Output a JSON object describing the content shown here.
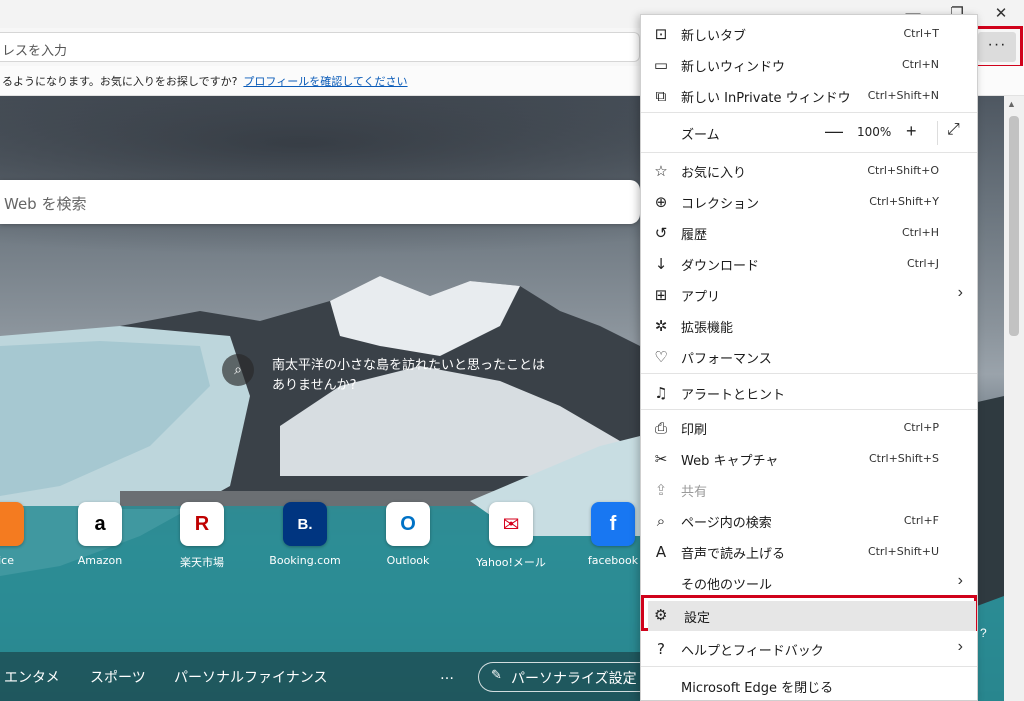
{
  "window": {
    "minimize_icon": "minimize-icon",
    "restore_icon": "restore-icon",
    "close_icon": "close-icon"
  },
  "address_bar": {
    "placeholder": "レスを入力",
    "more_button_label": "···"
  },
  "infobar": {
    "text": "るようになります。お気に入りをお探しですか?",
    "link": "プロフィールを確認してください"
  },
  "newtab": {
    "search_placeholder": "Web を検索",
    "caption_icon_label": "⌕",
    "caption": "南太平洋の小さな島を訪れたいと思ったことはありませんか?",
    "tiles": [
      {
        "label": "ice",
        "icon_text": "",
        "color": "#f47b20"
      },
      {
        "label": "Amazon",
        "icon_text": "a",
        "color": "#000000"
      },
      {
        "label": "楽天市場",
        "icon_text": "R",
        "color": "#bf0000"
      },
      {
        "label": "Booking.com",
        "icon_text": "B.",
        "color": "#003580"
      },
      {
        "label": "Outlook",
        "icon_text": "O",
        "color": "#0072c6"
      },
      {
        "label": "Yahoo!メール",
        "icon_text": "✉",
        "color": "#d6001c"
      },
      {
        "label": "facebook",
        "icon_text": "f",
        "color": "#1877f2"
      }
    ],
    "nav": [
      "エンタメ",
      "スポーツ",
      "パーソナルファイナンス",
      "…"
    ],
    "personalize": "パーソナライズ設定",
    "right_hint": "?"
  },
  "menu": {
    "new_tab": {
      "label": "新しいタブ",
      "shortcut": "Ctrl+T",
      "icon": "new-tab-icon"
    },
    "new_window": {
      "label": "新しいウィンドウ",
      "shortcut": "Ctrl+N",
      "icon": "new-window-icon"
    },
    "inprivate": {
      "label": "新しい InPrivate ウィンドウ",
      "shortcut": "Ctrl+Shift+N",
      "icon": "inprivate-icon"
    },
    "zoom": {
      "label": "ズーム",
      "minus": "—",
      "value": "100%",
      "plus": "+",
      "fullscreen": "⤢"
    },
    "favorites": {
      "label": "お気に入り",
      "shortcut": "Ctrl+Shift+O",
      "icon": "favorites-icon"
    },
    "collections": {
      "label": "コレクション",
      "shortcut": "Ctrl+Shift+Y",
      "icon": "collections-icon"
    },
    "history": {
      "label": "履歴",
      "shortcut": "Ctrl+H",
      "icon": "history-icon"
    },
    "downloads": {
      "label": "ダウンロード",
      "shortcut": "Ctrl+J",
      "icon": "download-icon"
    },
    "apps": {
      "label": "アプリ",
      "chevron": "›",
      "icon": "apps-icon"
    },
    "extensions": {
      "label": "拡張機能",
      "icon": "extensions-icon"
    },
    "performance": {
      "label": "パフォーマンス",
      "icon": "performance-icon"
    },
    "alerts": {
      "label": "アラートとヒント",
      "icon": "bell-icon"
    },
    "print": {
      "label": "印刷",
      "shortcut": "Ctrl+P",
      "icon": "print-icon"
    },
    "web_capture": {
      "label": "Web キャプチャ",
      "shortcut": "Ctrl+Shift+S",
      "icon": "web-capture-icon"
    },
    "share": {
      "label": "共有",
      "icon": "share-icon"
    },
    "find": {
      "label": "ページ内の検索",
      "shortcut": "Ctrl+F",
      "icon": "find-icon"
    },
    "read_aloud": {
      "label": "音声で読み上げる",
      "shortcut": "Ctrl+Shift+U",
      "icon": "read-aloud-icon"
    },
    "more_tools": {
      "label": "その他のツール",
      "chevron": "›"
    },
    "settings": {
      "label": "設定",
      "icon": "gear-icon"
    },
    "help": {
      "label": "ヘルプとフィードバック",
      "chevron": "›",
      "icon": "help-icon"
    },
    "close": {
      "label": "Microsoft Edge を閉じる"
    }
  },
  "colors": {
    "highlight_red": "#d0021b",
    "link_blue": "#0a5bb8"
  }
}
